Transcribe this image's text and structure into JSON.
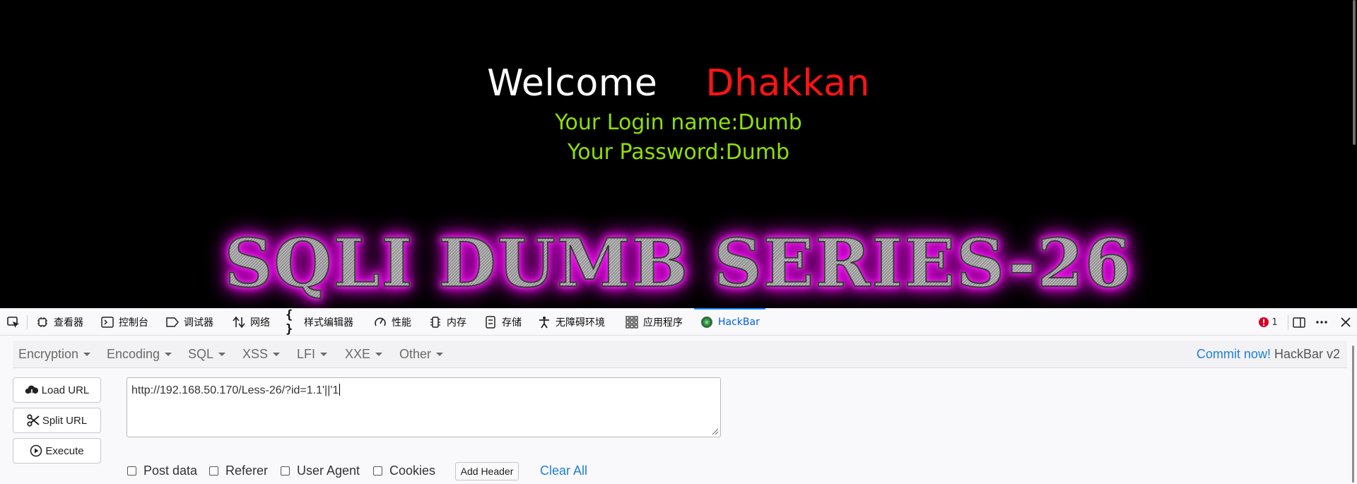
{
  "page": {
    "welcome": "Welcome",
    "name": "Dhakkan",
    "login_line": "Your Login name:Dumb",
    "password_line": "Your Password:Dumb",
    "banner": "SQLI DUMB SERIES-26"
  },
  "devtools": {
    "tabs": [
      {
        "label": "查看器",
        "icon": "inspector-icon"
      },
      {
        "label": "控制台",
        "icon": "console-icon"
      },
      {
        "label": "调试器",
        "icon": "debugger-icon"
      },
      {
        "label": "网络",
        "icon": "network-icon"
      },
      {
        "label": "样式编辑器",
        "icon": "style-editor-icon"
      },
      {
        "label": "性能",
        "icon": "performance-icon"
      },
      {
        "label": "内存",
        "icon": "memory-icon"
      },
      {
        "label": "存储",
        "icon": "storage-icon"
      },
      {
        "label": "无障碍环境",
        "icon": "accessibility-icon"
      },
      {
        "label": "应用程序",
        "icon": "application-icon"
      },
      {
        "label": "HackBar",
        "icon": "hackbar-icon",
        "active": true
      }
    ],
    "error_count": "1"
  },
  "hackbar": {
    "menus": [
      "Encryption",
      "Encoding",
      "SQL",
      "XSS",
      "LFI",
      "XXE",
      "Other"
    ],
    "commit_link": "Commit now!",
    "version": "HackBar v2",
    "buttons": {
      "load_url": "Load URL",
      "split_url": "Split URL",
      "execute": "Execute"
    },
    "url_value": "http://192.168.50.170/Less-26/?id=1.1'||'1",
    "options": [
      "Post data",
      "Referer",
      "User Agent",
      "Cookies"
    ],
    "add_header": "Add Header",
    "clear_all": "Clear All"
  },
  "colors": {
    "welcome": "#ffffff",
    "name": "#ff1414",
    "info": "#8fe000",
    "banner_glow": "#e000e0",
    "link": "#1e7fd6",
    "active_tab": "#0060df"
  }
}
